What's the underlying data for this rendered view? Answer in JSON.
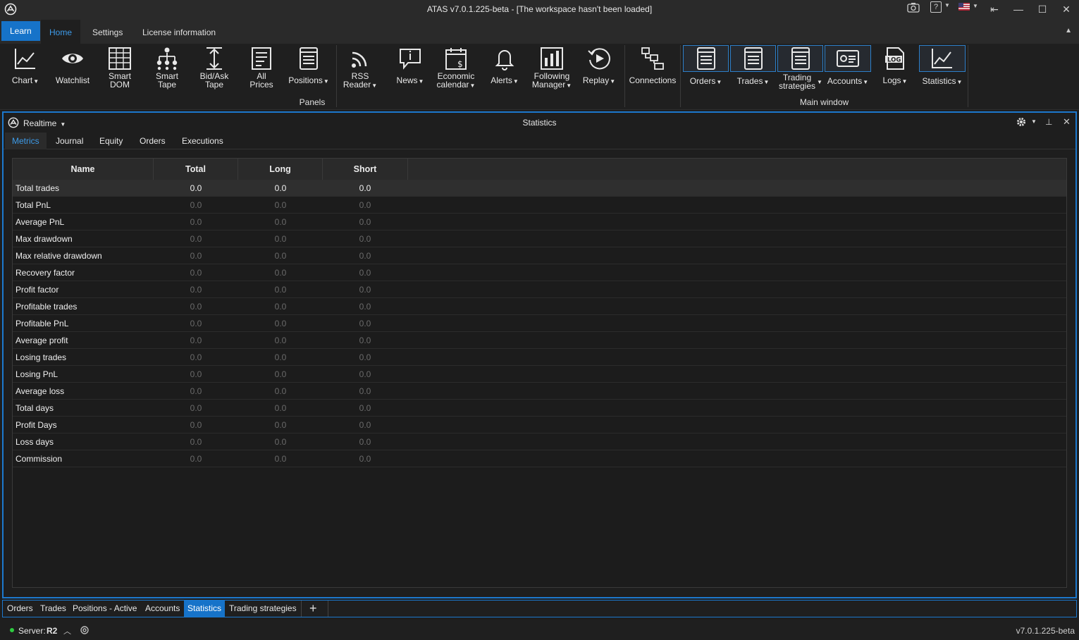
{
  "window": {
    "title": "ATAS v7.0.1.225-beta - [The workspace hasn't been loaded]",
    "controls": {
      "minimize": "—",
      "maximize": "☐",
      "close": "✕",
      "pin": "⇤"
    }
  },
  "ribbon_tabs": [
    "Learn",
    "Home",
    "Settings",
    "License information"
  ],
  "ribbon": {
    "chart": "Chart",
    "watchlist": "Watchlist",
    "smart_dom": [
      "Smart",
      "DOM"
    ],
    "smart_tape": [
      "Smart",
      "Tape"
    ],
    "bid_ask_tape": [
      "Bid/Ask",
      "Tape"
    ],
    "all_prices": [
      "All",
      "Prices"
    ],
    "positions": "Positions",
    "rss_reader": [
      "RSS",
      "Reader"
    ],
    "news": "News",
    "economic_calendar": [
      "Economic",
      "calendar"
    ],
    "alerts": "Alerts",
    "following_manager": [
      "Following",
      "Manager"
    ],
    "replay": "Replay",
    "connections": "Connections",
    "orders": "Orders",
    "trades": "Trades",
    "trading_strategies": [
      "Trading",
      "strategies"
    ],
    "accounts": "Accounts",
    "logs": "Logs",
    "statistics": "Statistics",
    "group_panels": "Panels",
    "group_main_window": "Main window"
  },
  "panel": {
    "title": "Statistics",
    "mode": "Realtime",
    "tabs": [
      "Metrics",
      "Journal",
      "Equity",
      "Orders",
      "Executions"
    ],
    "active_tab": "Metrics"
  },
  "grid": {
    "columns": [
      "Name",
      "Total",
      "Long",
      "Short"
    ],
    "rows": [
      [
        "Total trades",
        "0.0",
        "0.0",
        "0.0"
      ],
      [
        "Total PnL",
        "0.0",
        "0.0",
        "0.0"
      ],
      [
        "Average PnL",
        "0.0",
        "0.0",
        "0.0"
      ],
      [
        "Max drawdown",
        "0.0",
        "0.0",
        "0.0"
      ],
      [
        "Max relative drawdown",
        "0.0",
        "0.0",
        "0.0"
      ],
      [
        "Recovery factor",
        "0.0",
        "0.0",
        "0.0"
      ],
      [
        "Profit factor",
        "0.0",
        "0.0",
        "0.0"
      ],
      [
        "Profitable trades",
        "0.0",
        "0.0",
        "0.0"
      ],
      [
        "Profitable PnL",
        "0.0",
        "0.0",
        "0.0"
      ],
      [
        "Average profit",
        "0.0",
        "0.0",
        "0.0"
      ],
      [
        "Losing trades",
        "0.0",
        "0.0",
        "0.0"
      ],
      [
        "Losing PnL",
        "0.0",
        "0.0",
        "0.0"
      ],
      [
        "Average loss",
        "0.0",
        "0.0",
        "0.0"
      ],
      [
        "Total days",
        "0.0",
        "0.0",
        "0.0"
      ],
      [
        "Profit Days",
        "0.0",
        "0.0",
        "0.0"
      ],
      [
        "Loss days",
        "0.0",
        "0.0",
        "0.0"
      ],
      [
        "Commission",
        "0.0",
        "0.0",
        "0.0"
      ]
    ]
  },
  "dock_tabs": [
    "Orders",
    "Trades",
    "Positions - Active",
    "Accounts",
    "Statistics",
    "Trading strategies"
  ],
  "dock_active": "Statistics",
  "dock_add": "+",
  "status": {
    "server_label": "Server:",
    "server_value": "R2",
    "version": "v7.0.1.225-beta"
  },
  "colors": {
    "accent": "#1673c9",
    "tab_active_text": "#3d9be9",
    "server_dot": "#2ecc40"
  }
}
